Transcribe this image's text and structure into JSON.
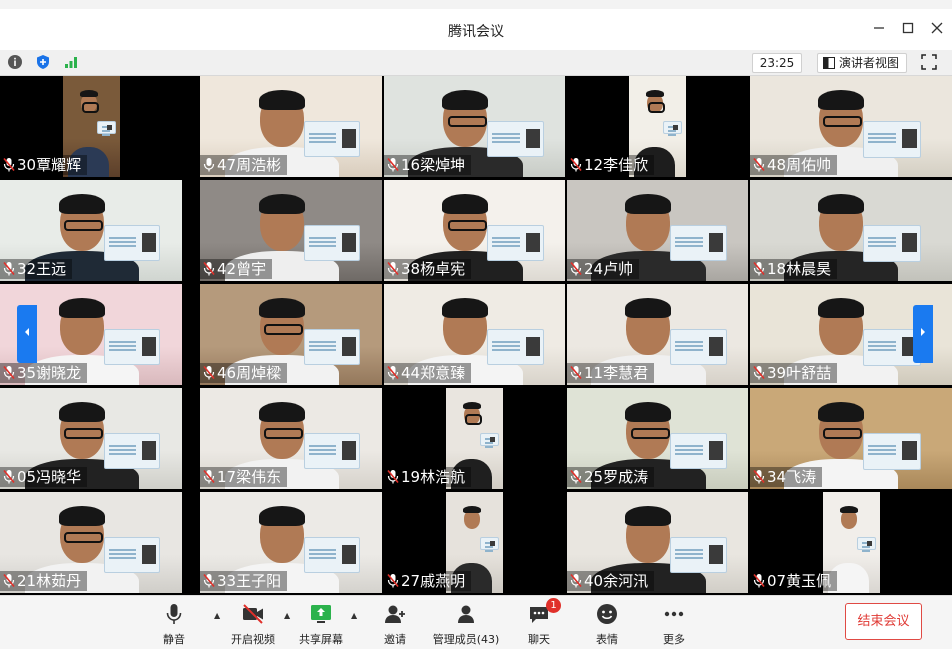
{
  "window": {
    "title": "腾讯会议"
  },
  "infobar": {
    "timer": "23:25",
    "presenter_view_label": "演讲者视图"
  },
  "participants": [
    {
      "name": "30覃耀辉",
      "muted": true
    },
    {
      "name": "47周浩彬",
      "muted": false
    },
    {
      "name": "16梁焯坤",
      "muted": true
    },
    {
      "name": "12李佳欣",
      "muted": true
    },
    {
      "name": "48周佑帅",
      "muted": true
    },
    {
      "name": "32王远",
      "muted": true
    },
    {
      "name": "42曾宇",
      "muted": true
    },
    {
      "name": "38杨卓宪",
      "muted": true
    },
    {
      "name": "24卢帅",
      "muted": true
    },
    {
      "name": "18林晨昊",
      "muted": true
    },
    {
      "name": "35谢晓龙",
      "muted": true
    },
    {
      "name": "46周焯樑",
      "muted": true
    },
    {
      "name": "44郑意臻",
      "muted": true
    },
    {
      "name": "11李慧君",
      "muted": true
    },
    {
      "name": "39叶舒喆",
      "muted": true
    },
    {
      "name": "05冯晓华",
      "muted": true
    },
    {
      "name": "17梁伟东",
      "muted": true
    },
    {
      "name": "19林浩航",
      "muted": true
    },
    {
      "name": "25罗成涛",
      "muted": true
    },
    {
      "name": "34飞涛",
      "muted": true
    },
    {
      "name": "21林茹丹",
      "muted": true
    },
    {
      "name": "33王子阳",
      "muted": true
    },
    {
      "name": "27戚燕明",
      "muted": true
    },
    {
      "name": "40余河汛",
      "muted": true
    },
    {
      "name": "07黄玉佩",
      "muted": true
    }
  ],
  "toolbar": {
    "mute_label": "静音",
    "video_label": "开启视频",
    "share_label": "共享屏幕",
    "invite_label": "邀请",
    "members_label": "管理成员(43)",
    "chat_label": "聊天",
    "chat_badge": "1",
    "reactions_label": "表情",
    "more_label": "更多",
    "end_meeting_label": "结束会议"
  },
  "colors": {
    "accent_blue": "#1a7af0",
    "end_red": "#e03a35",
    "badge_red": "#e0302a",
    "shield_blue": "#1a73e8",
    "signal_green": "#2bb24c"
  }
}
